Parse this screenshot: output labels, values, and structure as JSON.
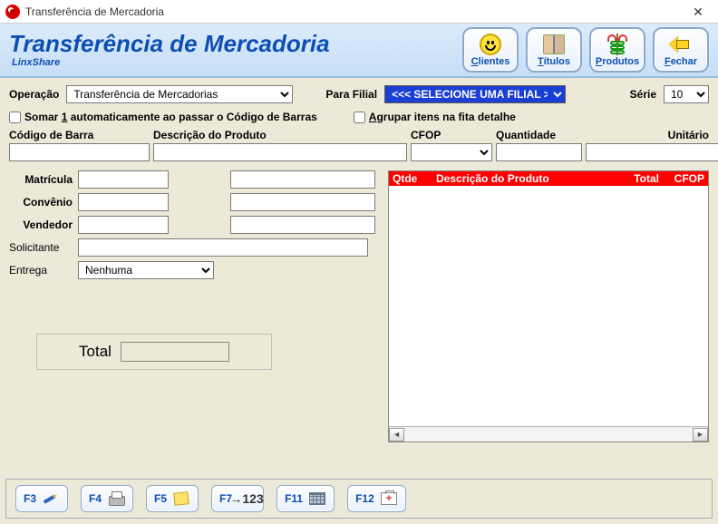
{
  "window": {
    "title": "Transferência de Mercadoria"
  },
  "header": {
    "bigtitle": "Transferência de Mercadoria",
    "subtitle": "LinxShare",
    "buttons": {
      "clientes": "Clientes",
      "titulos": "Títulos",
      "produtos": "Produtos",
      "fechar": "Fechar"
    }
  },
  "filters": {
    "operacao_label": "Operação",
    "operacao_value": "Transferência de Mercadorias",
    "para_filial_label": "Para Filial",
    "para_filial_value": "<<< SELECIONE UMA FILIAL >>>",
    "serie_label": "Série",
    "serie_value": "10"
  },
  "checkboxes": {
    "somar1": "Somar 1 automaticamente ao passar o Código de Barras",
    "agrupar": "Agrupar itens na fita detalhe"
  },
  "columns": {
    "codigo": "Código de Barra",
    "descricao": "Descrição do Produto",
    "cfop": "CFOP",
    "quantidade": "Quantidade",
    "unitario": "Unitário"
  },
  "fields": {
    "matricula": "Matrícula",
    "convenio": "Convênio",
    "vendedor": "Vendedor",
    "solicitante": "Solicitante",
    "entrega": "Entrega",
    "entrega_value": "Nenhuma"
  },
  "total_label": "Total",
  "list_header": {
    "qtde": "Qtde",
    "descricao": "Descrição do Produto",
    "total": "Total",
    "cfop": "CFOP"
  },
  "footer": {
    "f3": "F3",
    "f4": "F4",
    "f5": "F5",
    "f7": "F7",
    "f11": "F11",
    "f12": "F12",
    "f7_extra": "→123"
  }
}
